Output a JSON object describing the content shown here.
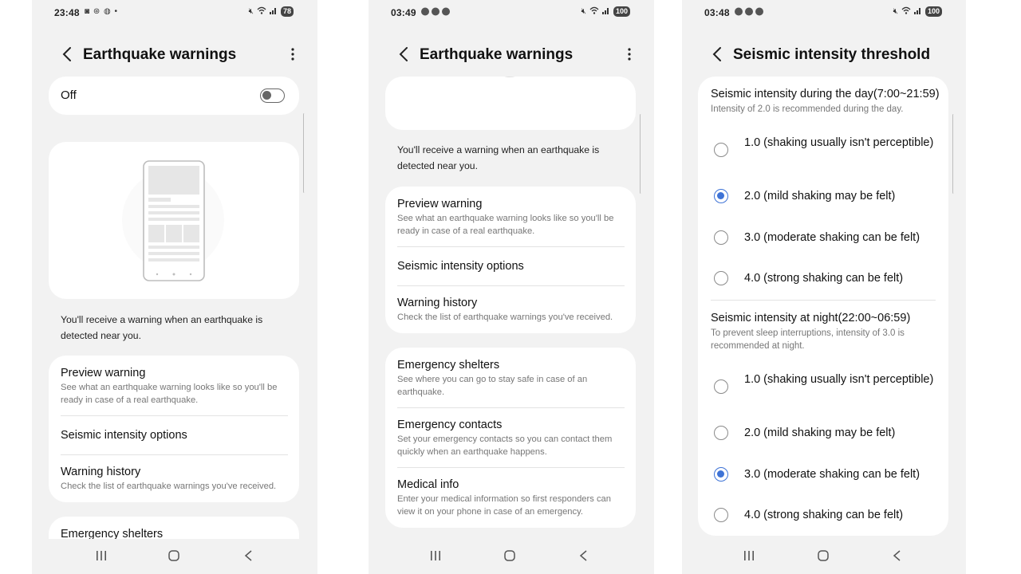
{
  "screen1": {
    "status": {
      "time": "23:48",
      "icons": "◙ ⊛ ◍ •",
      "battery": "78"
    },
    "title": "Earthquake warnings",
    "master_toggle_label": "Off",
    "description": "You'll receive a warning when an earthquake is detected near you.",
    "items": [
      {
        "title": "Preview warning",
        "subtitle": "See what an earthquake warning looks like so you'll be ready in case of a real earthquake."
      },
      {
        "title": "Seismic intensity options"
      },
      {
        "title": "Warning history",
        "subtitle": "Check the list of earthquake warnings you've received."
      }
    ],
    "peek_item": "Emergency shelters"
  },
  "screen2": {
    "status": {
      "time": "03:49",
      "battery": "100"
    },
    "title": "Earthquake warnings",
    "description": "You'll receive a warning when an earthquake is detected near you.",
    "items": [
      {
        "title": "Preview warning",
        "subtitle": "See what an earthquake warning looks like so you'll be ready in case of a real earthquake."
      },
      {
        "title": "Seismic intensity options"
      },
      {
        "title": "Warning history",
        "subtitle": "Check the list of earthquake warnings you've received."
      }
    ],
    "items2": [
      {
        "title": "Emergency shelters",
        "subtitle": "See where you can go to stay safe in case of an earthquake."
      },
      {
        "title": "Emergency contacts",
        "subtitle": "Set your emergency contacts so you can contact them quickly when an earthquake happens."
      },
      {
        "title": "Medical info",
        "subtitle": "Enter your medical information so first responders can view it on your phone in case of an emergency."
      }
    ]
  },
  "screen3": {
    "status": {
      "time": "03:48",
      "battery": "100"
    },
    "title": "Seismic intensity threshold",
    "day": {
      "heading": "Seismic intensity during the day(7:00~21:59)",
      "subtitle": "Intensity of 2.0 is recommended during the day.",
      "options": [
        "1.0 (shaking usually isn't perceptible)",
        "2.0 (mild shaking may be felt)",
        "3.0 (moderate shaking can be felt)",
        "4.0 (strong shaking can be felt)"
      ],
      "selected_index": 1
    },
    "night": {
      "heading": "Seismic intensity at night(22:00~06:59)",
      "subtitle": "To prevent sleep interruptions, intensity of 3.0 is recommended at night.",
      "options": [
        "1.0 (shaking usually isn't perceptible)",
        "2.0 (mild shaking may be felt)",
        "3.0 (moderate shaking can be felt)",
        "4.0 (strong shaking can be felt)"
      ],
      "selected_index": 2
    }
  },
  "colors": {
    "accent": "#3e73d6",
    "background": "#f2f2f2",
    "card": "#ffffff"
  },
  "icons": {
    "back": "chevron-left-icon",
    "more": "more-vertical-icon",
    "nav_recents": "recents-icon",
    "nav_home": "home-icon",
    "nav_back": "back-icon"
  }
}
